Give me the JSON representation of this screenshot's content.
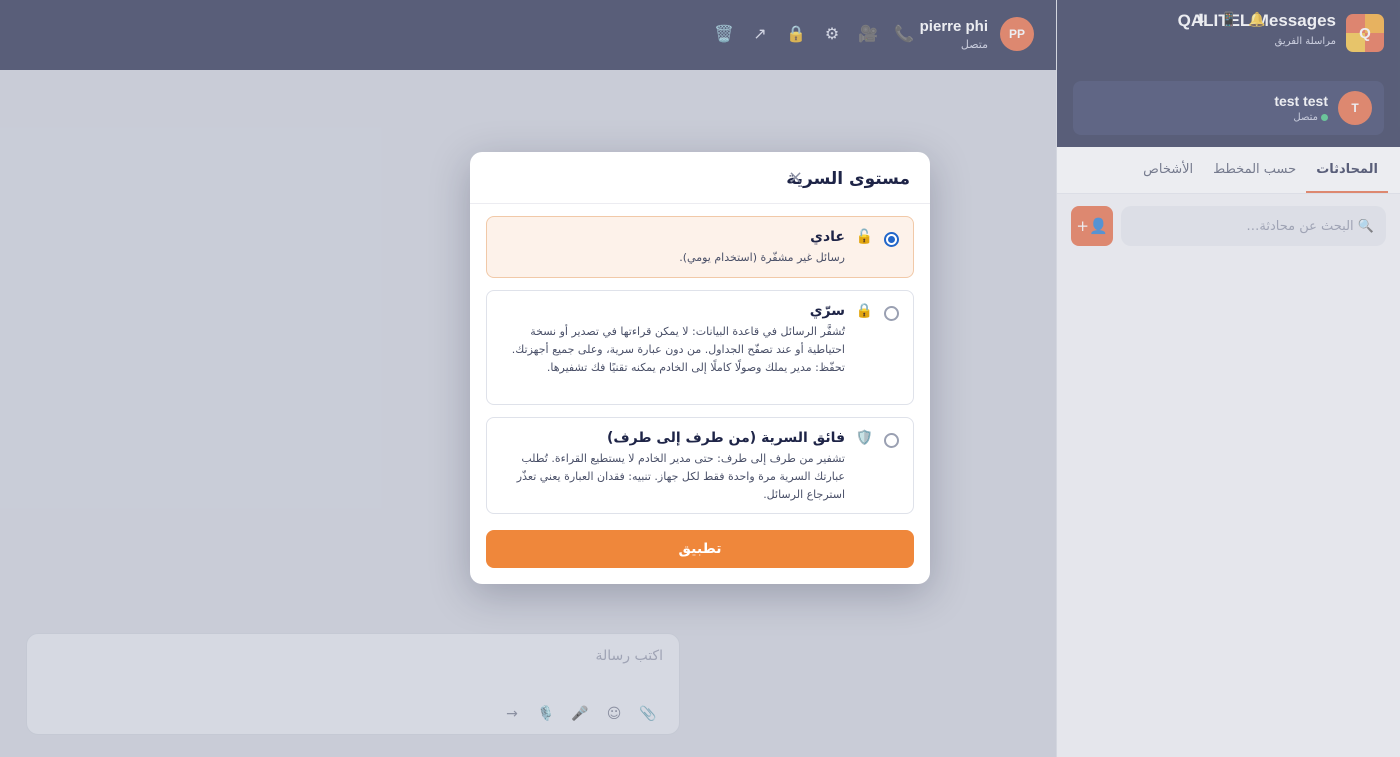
{
  "app": {
    "name": "QALITEL Messages",
    "logo_letter": "Q",
    "subtitle": "مراسلة الفريق",
    "header_icons": [
      "download-icon",
      "phone-device-icon",
      "bell-icon"
    ]
  },
  "current_user": {
    "initial": "T",
    "name": "test test",
    "status": "متصل"
  },
  "sidebar": {
    "tabs": [
      {
        "label": "المحادثات",
        "active": true
      },
      {
        "label": "حسب المخطط",
        "active": false
      },
      {
        "label": "الأشخاص",
        "active": false
      }
    ],
    "search_placeholder": "🔍 البحث عن محادثة…",
    "add_label": "👤+"
  },
  "chat": {
    "peer_initials": "PP",
    "peer_name": "pierre phi",
    "peer_status": "متصل",
    "toolbar_icons": [
      "phone-icon",
      "video-icon",
      "settings-icon",
      "lock-icon",
      "share-icon",
      "trash-icon"
    ],
    "composer_placeholder": "اكتب رسالة",
    "composer_tools": [
      "attach-icon",
      "emoji-icon",
      "microphone-icon",
      "podcast-icon",
      "send-icon"
    ]
  },
  "modal": {
    "title": "مستوى السرية",
    "close": "×",
    "options": [
      {
        "icon": "🔓",
        "title": "عادي",
        "desc": "رسائل غير مشفّرة (استخدام يومي).",
        "selected": true
      },
      {
        "icon": "🔒",
        "title": "سرّي",
        "desc": "تُشفَّر الرسائل في قاعدة البيانات: لا يمكن قراءتها في تصدير أو نسخة احتياطية أو عند تصفّح الجداول. من دون عبارة سرية، وعلى جميع أجهزتك. تحفّظ: مدير يملك وصولًا كاملًا إلى الخادم يمكنه تقنيًا فك تشفيرها.",
        "selected": false
      },
      {
        "icon": "🛡️",
        "title": "فائق السرية (من طرف إلى طرف)",
        "desc": "تشفير من طرف إلى طرف: حتى مدير الخادم لا يستطيع القراءة. تُطلب عبارتك السرية مرة واحدة فقط لكل جهاز. تنبيه: فقدان العبارة يعني تعذّر استرجاع الرسائل.",
        "selected": false
      }
    ],
    "apply_label": "تطبيق"
  },
  "colors": {
    "navy": "#1e2447",
    "accent": "#e9653a",
    "apply": "#ef873b",
    "radio": "#2166c9",
    "online": "#3ac27a"
  }
}
